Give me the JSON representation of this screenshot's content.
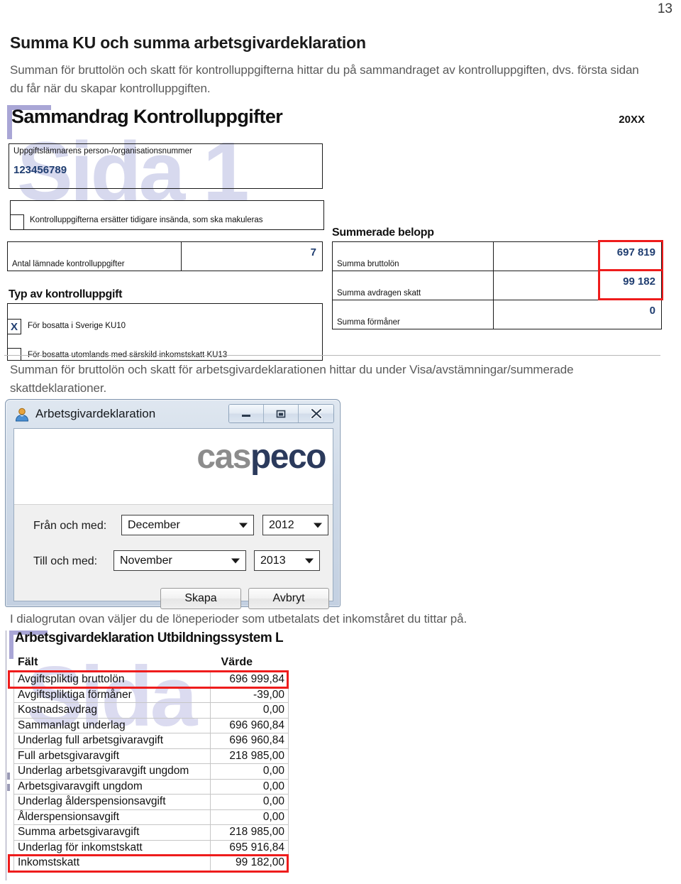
{
  "page": {
    "number": "13"
  },
  "document": {
    "heading": "Summa KU och summa arbetsgivardeklaration",
    "paragraph1": "Summan för bruttolön och skatt för kontrolluppgifterna hittar du på sammandraget av kontrolluppgiften, dvs. första sidan du får när du skapar kontrolluppgiften.",
    "paragraph2": "Summan för bruttolön och skatt för arbetsgivardeklarationen hittar du under Visa/avstämningar/summerade skattdeklarationer.",
    "paragraph3": "I dialogrutan ovan väljer du de löneperioder som utbetalats det inkomståret du tittar på."
  },
  "ku_form": {
    "watermark": "Sida 1",
    "title": "Sammandrag Kontrolluppgifter",
    "year": "20XX",
    "org_number_label": "Uppgiftslämnarens person-/organisationsnummer",
    "org_number_value": "123456789",
    "replace_checkbox_label": "Kontrolluppgifterna ersätter tidigare insända, som ska makuleras",
    "replace_checkbox_value": "",
    "count_label": "Antal lämnade kontrolluppgifter",
    "count_value": "7",
    "type_section_title": "Typ av kontrolluppgift",
    "type_options": [
      {
        "label": "För bosatta i Sverige KU10",
        "checked": "X"
      },
      {
        "label": "För bosatta utomlands med särskild inkomstskatt KU13",
        "checked": ""
      }
    ],
    "amounts_section_title": "Summerade belopp",
    "amounts": [
      {
        "label": "Summa bruttolön",
        "value": "697 819",
        "highlighted": true
      },
      {
        "label": "Summa avdragen skatt",
        "value": "99 182",
        "highlighted": true
      },
      {
        "label": "Summa förmåner",
        "value": "0",
        "highlighted": false
      }
    ]
  },
  "dialog": {
    "title": "Arbetsgivardeklaration",
    "logo_part1": "cas",
    "logo_part2": "peco",
    "window_buttons": {
      "minimize": "minimize-icon",
      "maximize": "maximize-icon",
      "close": "close-icon"
    },
    "fields": {
      "from_label": "Från och med:",
      "from_month": "December",
      "from_year": "2012",
      "to_label": "Till och med:",
      "to_month": "November",
      "to_year": "2013"
    },
    "buttons": {
      "create": "Skapa",
      "cancel": "Avbryt"
    }
  },
  "report": {
    "watermark": "Sida",
    "title": "Arbetsgivardeklaration Utbildningssystem L",
    "columns": [
      "Fält",
      "Värde"
    ],
    "rows": [
      {
        "field": "Avgiftspliktig bruttolön",
        "value": "696 999,84",
        "highlighted": true
      },
      {
        "field": "Avgiftspliktiga förmåner",
        "value": "-39,00",
        "highlighted": false
      },
      {
        "field": "Kostnadsavdrag",
        "value": "0,00",
        "highlighted": false
      },
      {
        "field": "Sammanlagt underlag",
        "value": "696 960,84",
        "highlighted": false
      },
      {
        "field": "Underlag full arbetsgivaravgift",
        "value": "696 960,84",
        "highlighted": false
      },
      {
        "field": "Full arbetsgivaravgift",
        "value": "218 985,00",
        "highlighted": false
      },
      {
        "field": "Underlag arbetsgivaravgift ungdom",
        "value": "0,00",
        "highlighted": false
      },
      {
        "field": "Arbetsgivaravgift ungdom",
        "value": "0,00",
        "highlighted": false
      },
      {
        "field": "Underlag ålderspensionsavgift",
        "value": "0,00",
        "highlighted": false
      },
      {
        "field": "Ålderspensionsavgift",
        "value": "0,00",
        "highlighted": false
      },
      {
        "field": "Summa arbetsgivaravgift",
        "value": "218 985,00",
        "highlighted": false
      },
      {
        "field": "Underlag för inkomstskatt",
        "value": "695 916,84",
        "highlighted": false
      },
      {
        "field": "Inkomstskatt",
        "value": "99 182,00",
        "highlighted": true
      }
    ]
  },
  "colors": {
    "highlight_red": "#ee1c1c",
    "form_value_blue": "#1f3d70",
    "watermark_purple": "#c9cbe8",
    "prose_gray": "#5a5a5a",
    "logo_gray": "#8c8c8c",
    "logo_navy": "#2b3a5c"
  }
}
